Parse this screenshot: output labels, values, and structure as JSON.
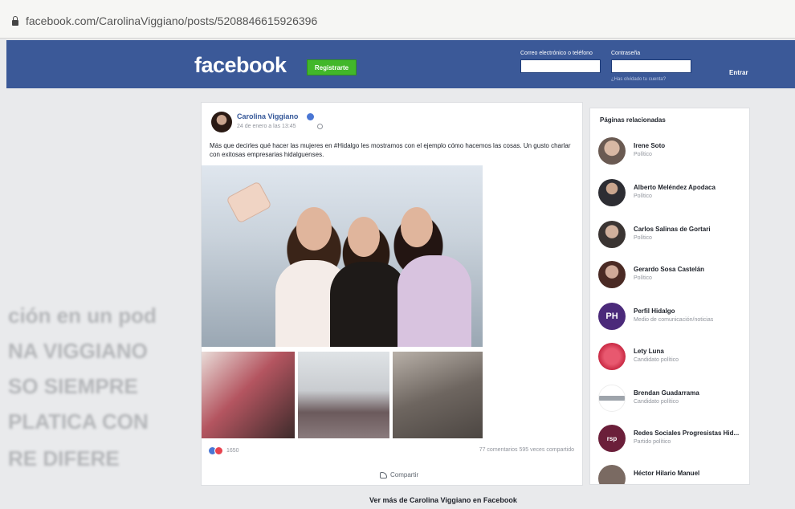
{
  "browser": {
    "url": "facebook.com/CarolinaViggiano/posts/5208846615926396"
  },
  "header": {
    "logo": "facebook",
    "register_label": "Registrarte",
    "email_label": "Correo electrónico o teléfono",
    "password_label": "Contraseña",
    "forgot_label": "¿Has olvidado tu cuenta?",
    "login_label": "Entrar",
    "brand_color": "#3b5998"
  },
  "post": {
    "author": "Carolina Viggiano",
    "date": "24 de enero a las 13:45",
    "text": "Más que decirles qué hacer las mujeres en #Hidalgo les mostramos con el ejemplo cómo hacemos las cosas. Un gusto charlar con exitosas empresarias hidalguenses.",
    "reactions_count": "1650",
    "engagement": "77 comentarios  595 veces compartido",
    "share_label": "Compartir"
  },
  "related": {
    "title": "Páginas relacionadas",
    "items": [
      {
        "name": "Irene Soto",
        "sub": "Político"
      },
      {
        "name": "Alberto Meléndez Apodaca",
        "sub": "Político"
      },
      {
        "name": "Carlos Salinas de Gortari",
        "sub": "Político"
      },
      {
        "name": "Gerardo Sosa Castelán",
        "sub": "Político"
      },
      {
        "name": "Perfil Hidalgo",
        "sub": "Medio de comunicación/noticias",
        "initials": "PH"
      },
      {
        "name": "Lety Luna",
        "sub": "Candidato político"
      },
      {
        "name": "Brendan Guadarrama",
        "sub": "Candidato político"
      },
      {
        "name": "Redes Sociales Progresistas Hid...",
        "sub": "Partido político",
        "initials": "rsp"
      },
      {
        "name": "Héctor Hilario Manuel",
        "sub": ""
      }
    ]
  },
  "footer": {
    "see_more": "Ver más de Carolina Viggiano en Facebook"
  },
  "background": {
    "lines": [
      "ción en un pod",
      "NA VIGGIANO",
      "SO SIEMPRE",
      "PLATICA CON",
      "RE DIFERE"
    ]
  }
}
